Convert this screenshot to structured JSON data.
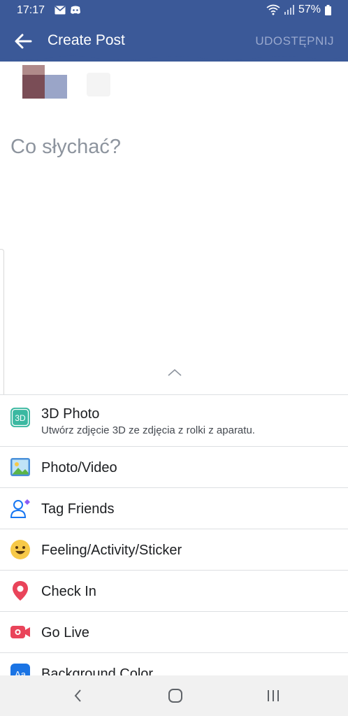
{
  "status_bar": {
    "time": "17:17",
    "battery": "57%",
    "icons": [
      "gmail-icon",
      "discord-icon",
      "wifi-icon",
      "signal-icon",
      "battery-icon"
    ]
  },
  "app_bar": {
    "title": "Create Post",
    "share_label": "UDOSTĘPNIJ",
    "back_icon": "arrow-left-icon"
  },
  "composer": {
    "placeholder": "Co słychać?"
  },
  "menu": {
    "items": [
      {
        "label": "3D Photo",
        "sublabel": "Utwórz zdjęcie 3D ze zdjęcia z rolki z aparatu.",
        "icon": "3d-photo-icon"
      },
      {
        "label": "Photo/Video",
        "icon": "photo-icon"
      },
      {
        "label": "Tag Friends",
        "icon": "tag-friends-icon"
      },
      {
        "label": "Feeling/Activity/Sticker",
        "icon": "smiley-icon"
      },
      {
        "label": "Check In",
        "icon": "location-pin-icon"
      },
      {
        "label": "Go Live",
        "icon": "live-camera-icon"
      },
      {
        "label": "Background Color",
        "icon": "background-color-icon"
      }
    ]
  },
  "nav_bar": {
    "icons": [
      "back-nav-icon",
      "home-nav-icon",
      "recents-nav-icon"
    ]
  },
  "colors": {
    "brand": "#3b5998",
    "share_disabled": "#9aa9ce",
    "placeholder": "#8d949e"
  }
}
